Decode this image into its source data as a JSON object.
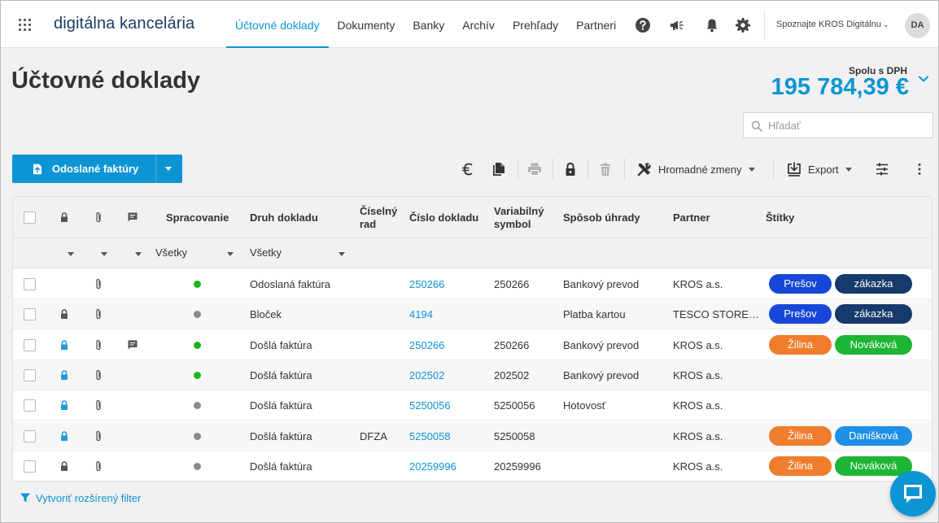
{
  "brand": "digitálna kancelária",
  "nav": [
    {
      "label": "Účtovné doklady",
      "active": true
    },
    {
      "label": "Dokumenty"
    },
    {
      "label": "Banky"
    },
    {
      "label": "Archív"
    },
    {
      "label": "Prehľady"
    },
    {
      "label": "Partneri"
    }
  ],
  "topbar_icons": [
    "help-icon",
    "megaphone-icon",
    "bell-icon",
    "gear-icon"
  ],
  "user_menu": "Spoznajte KROS Digitálnu",
  "avatar": "DA",
  "page_title": "Účtovné doklady",
  "summary": {
    "label": "Spolu s DPH",
    "value": "195 784,39 €"
  },
  "search": {
    "placeholder": "Hľadať"
  },
  "toolbar": {
    "primary_button": "Odoslané faktúry",
    "icons": [
      "euro-icon",
      "copy-icon",
      "print-icon",
      "lock-icon",
      "trash-icon"
    ],
    "bulk_changes": "Hromadné zmeny",
    "export": "Export"
  },
  "table": {
    "columns": {
      "processing": "Spracovanie",
      "doc_type": "Druh dokladu",
      "series_line1": "Číselný",
      "series_line2": "rad",
      "doc_number": "Číslo dokladu",
      "var_symbol_line1": "Variabilný",
      "var_symbol_line2": "symbol",
      "payment": "Spôsob úhrady",
      "partner": "Partner",
      "tags": "Štítky"
    },
    "filters": {
      "processing": "Všetky",
      "doc_type": "Všetky"
    },
    "rows": [
      {
        "lock": "none",
        "attachment": true,
        "comment": false,
        "status": "green",
        "doc_type": "Odoslaná faktúra",
        "series": "",
        "doc_number": "250266",
        "var_symbol": "250266",
        "payment": "Bankový prevod",
        "partner": "KROS a.s.",
        "tags": [
          {
            "label": "Prešov",
            "color": "#1747d8"
          },
          {
            "label": "zákazka",
            "color": "#163a6b"
          }
        ]
      },
      {
        "lock": "dark",
        "attachment": true,
        "comment": false,
        "status": "gray",
        "doc_type": "Bloček",
        "series": "",
        "doc_number": "4194",
        "var_symbol": "",
        "payment": "Platba kartou",
        "partner": "TESCO STORE…",
        "tags": [
          {
            "label": "Prešov",
            "color": "#1747d8"
          },
          {
            "label": "zákazka",
            "color": "#163a6b"
          }
        ]
      },
      {
        "lock": "blue",
        "attachment": true,
        "comment": true,
        "status": "green",
        "doc_type": "Došlá faktúra",
        "series": "",
        "doc_number": "250266",
        "var_symbol": "250266",
        "payment": "Bankový prevod",
        "partner": "KROS a.s.",
        "tags": [
          {
            "label": "Žilina",
            "color": "#f07d2c"
          },
          {
            "label": "Nováková",
            "color": "#1db535"
          }
        ]
      },
      {
        "lock": "blue",
        "attachment": true,
        "comment": false,
        "status": "green",
        "doc_type": "Došlá faktúra",
        "series": "",
        "doc_number": "202502",
        "var_symbol": "202502",
        "payment": "Bankový prevod",
        "partner": "KROS a.s.",
        "tags": []
      },
      {
        "lock": "blue",
        "attachment": true,
        "comment": false,
        "status": "gray",
        "doc_type": "Došlá faktúra",
        "series": "",
        "doc_number": "5250056",
        "var_symbol": "5250056",
        "payment": "Hotovosť",
        "partner": "KROS a.s.",
        "tags": []
      },
      {
        "lock": "blue",
        "attachment": true,
        "comment": false,
        "status": "gray",
        "doc_type": "Došlá faktúra",
        "series": "DFZA",
        "doc_number": "5250058",
        "var_symbol": "5250058",
        "payment": "",
        "partner": "KROS a.s.",
        "tags": [
          {
            "label": "Žilina",
            "color": "#f07d2c"
          },
          {
            "label": "Danišková",
            "color": "#1e90e6"
          }
        ]
      },
      {
        "lock": "dark",
        "attachment": true,
        "comment": false,
        "status": "gray",
        "doc_type": "Došlá faktúra",
        "series": "",
        "doc_number": "20259996",
        "var_symbol": "20259996",
        "payment": "",
        "partner": "KROS a.s.",
        "tags": [
          {
            "label": "Žilina",
            "color": "#f07d2c"
          },
          {
            "label": "Nováková",
            "color": "#1db535"
          }
        ]
      }
    ]
  },
  "advanced_filter": "Vytvoriť rozšírený filter",
  "colors": {
    "accent": "#0d95d3",
    "status_green": "#1db51d",
    "status_gray": "#8a8a8a"
  }
}
